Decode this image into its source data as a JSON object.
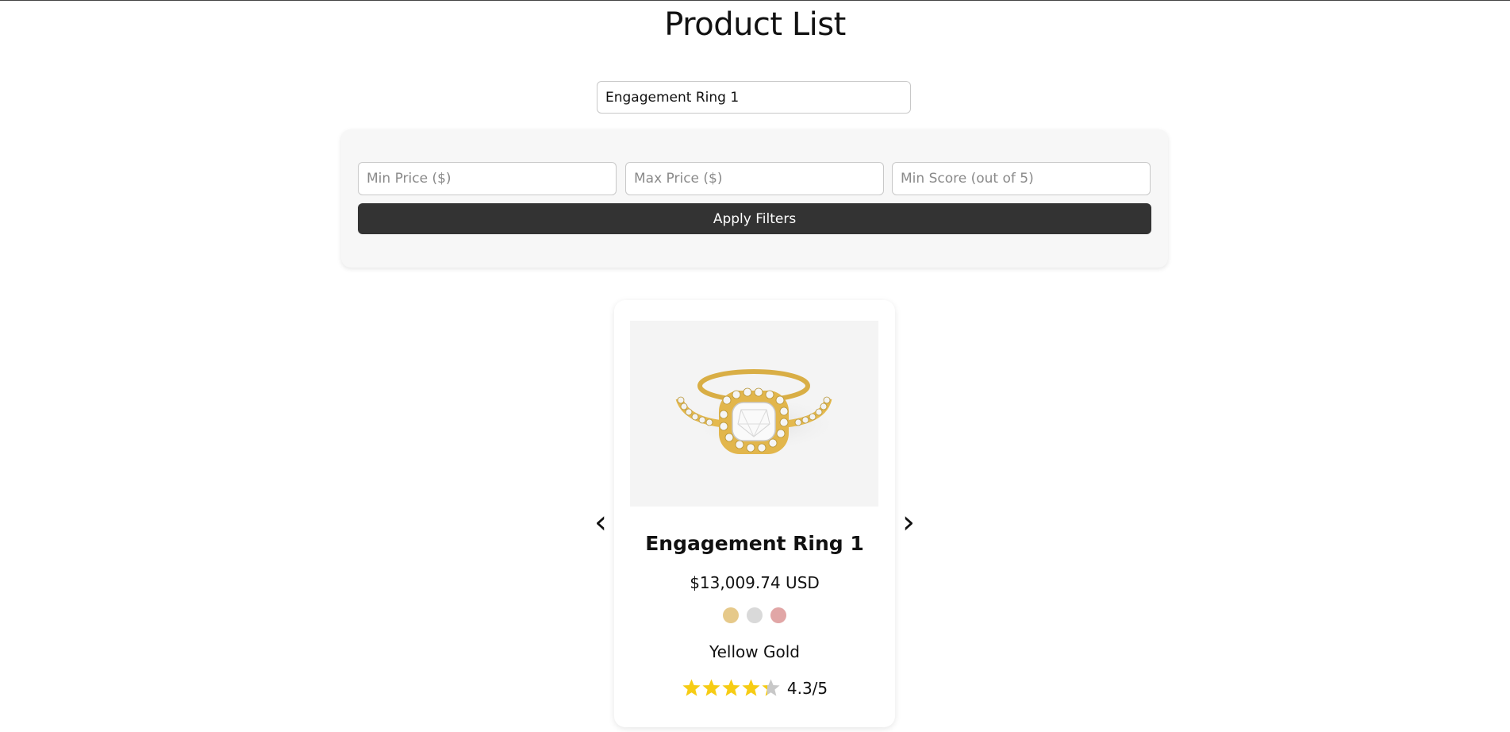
{
  "page": {
    "title": "Product List"
  },
  "search": {
    "value": "Engagement Ring 1"
  },
  "filters": {
    "min_price_placeholder": "Min Price ($)",
    "max_price_placeholder": "Max Price ($)",
    "min_score_placeholder": "Min Score (out of 5)",
    "apply_label": "Apply Filters"
  },
  "carousel": {
    "prev_icon": "‹",
    "next_icon": "›"
  },
  "product": {
    "name": "Engagement Ring 1",
    "price": "$13,009.74 USD",
    "selected_metal": "Yellow Gold",
    "swatches": [
      {
        "name": "yellow-gold",
        "color": "#E6C98A"
      },
      {
        "name": "white-gold",
        "color": "#D9D9D9"
      },
      {
        "name": "rose-gold",
        "color": "#E1A6A6"
      }
    ],
    "rating": {
      "value": 4.3,
      "text": "4.3/5",
      "max": 5
    }
  },
  "colors": {
    "star_filled": "#F6CC14",
    "star_empty": "#C8C8C8",
    "button_bg": "#333333"
  }
}
